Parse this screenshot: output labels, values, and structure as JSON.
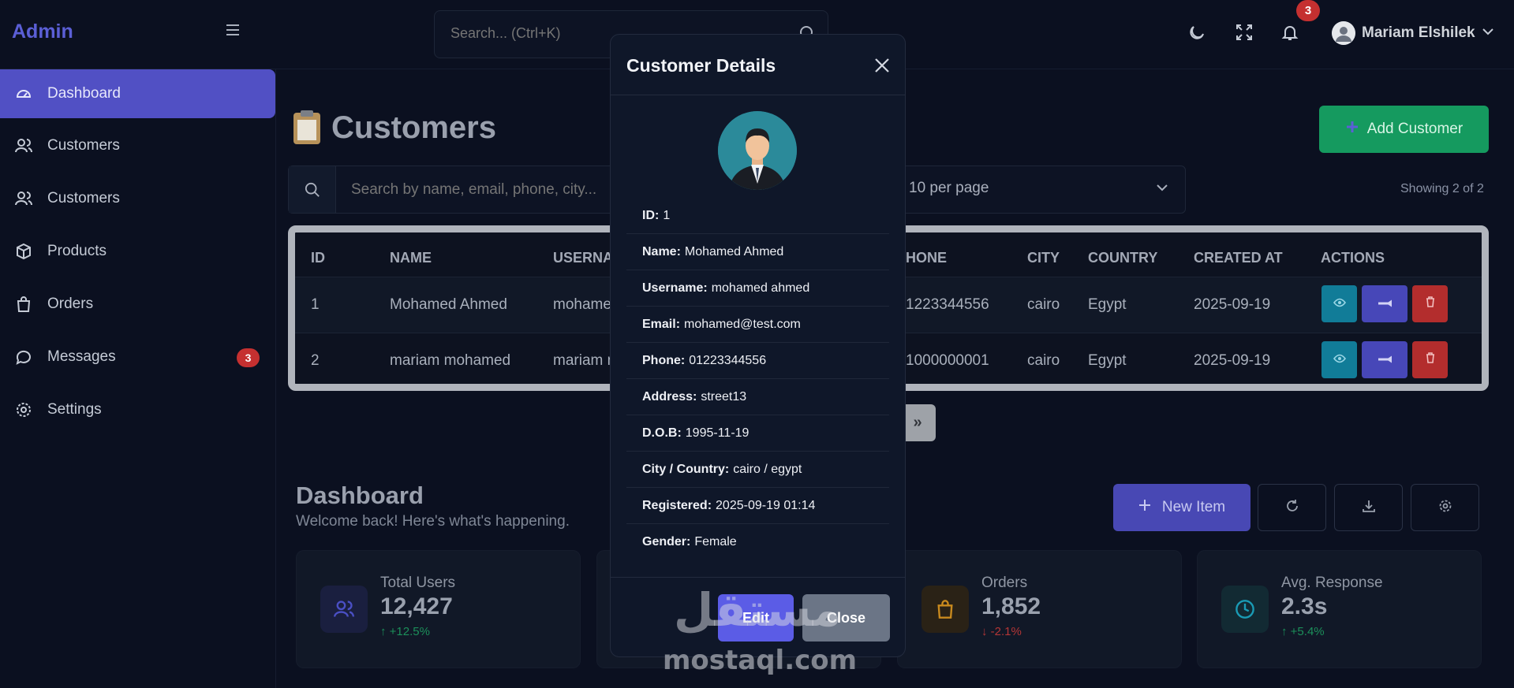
{
  "header": {
    "brand": "Admin",
    "search_placeholder": "Search... (Ctrl+K)",
    "notification_count": "3",
    "user_name": "Mariam Elshilek"
  },
  "sidebar": {
    "items": [
      {
        "label": "Dashboard",
        "icon": "gauge-icon",
        "active": true
      },
      {
        "label": "Customers",
        "icon": "users-icon"
      },
      {
        "label": "Customers",
        "icon": "users-icon"
      },
      {
        "label": "Products",
        "icon": "box-icon"
      },
      {
        "label": "Orders",
        "icon": "shopping-bag-icon"
      },
      {
        "label": "Messages",
        "icon": "chat-icon",
        "badge": "3"
      },
      {
        "label": "Settings",
        "icon": "gear-icon"
      }
    ]
  },
  "customers_page": {
    "title": "Customers",
    "add_button": "Add Customer",
    "filter_placeholder": "Search by name, email, phone, city...",
    "per_page": "10 per page",
    "showing": "Showing 2 of 2",
    "columns": [
      "ID",
      "NAME",
      "USERNAM",
      "HONE",
      "CITY",
      "COUNTRY",
      "CREATED AT",
      "ACTIONS"
    ],
    "rows": [
      {
        "id": "1",
        "name": "Mohamed Ahmed",
        "username": "mohamed",
        "phone": "1223344556",
        "city": "cairo",
        "country": "Egypt",
        "created": "2025-09-19"
      },
      {
        "id": "2",
        "name": "mariam mohamed",
        "username": "mariam m",
        "phone": "1000000001",
        "city": "cairo",
        "country": "Egypt",
        "created": "2025-09-19"
      }
    ],
    "pager_next": "»"
  },
  "dashboard": {
    "title": "Dashboard",
    "subtitle": "Welcome back! Here's what's happening.",
    "new_item": "New Item",
    "stats": [
      {
        "label": "Total Users",
        "value": "12,427",
        "delta": "+12.5%",
        "trend": "up",
        "icon": "users-icon",
        "color": "#4a4fc4"
      },
      {
        "label": "Orders",
        "value": "1,852",
        "delta": "-2.1%",
        "trend": "down",
        "icon": "shopping-bag-icon",
        "color": "#c98a1e"
      },
      {
        "label": "Avg. Response",
        "value": "2.3s",
        "delta": "+5.4%",
        "trend": "up",
        "icon": "clock-icon",
        "color": "#1a9bb5"
      }
    ]
  },
  "modal": {
    "title": "Customer Details",
    "fields": [
      {
        "label": "ID:",
        "value": "1"
      },
      {
        "label": "Name:",
        "value": "Mohamed Ahmed"
      },
      {
        "label": "Username:",
        "value": "mohamed ahmed"
      },
      {
        "label": "Email:",
        "value": "mohamed@test.com"
      },
      {
        "label": "Phone:",
        "value": "01223344556"
      },
      {
        "label": "Address:",
        "value": "street13"
      },
      {
        "label": "D.O.B:",
        "value": "1995-11-19"
      },
      {
        "label": "City / Country:",
        "value": "cairo / egypt"
      },
      {
        "label": "Registered:",
        "value": "2025-09-19 01:14"
      },
      {
        "label": "Gender:",
        "value": "Female"
      }
    ],
    "edit_label": "Edit",
    "close_label": "Close"
  },
  "watermark": {
    "text": "mostaql.com",
    "arabic": "مستقل"
  },
  "colors": {
    "accent": "#5150c4",
    "success": "#159a5f",
    "danger": "#c53030",
    "info": "#117c98"
  }
}
